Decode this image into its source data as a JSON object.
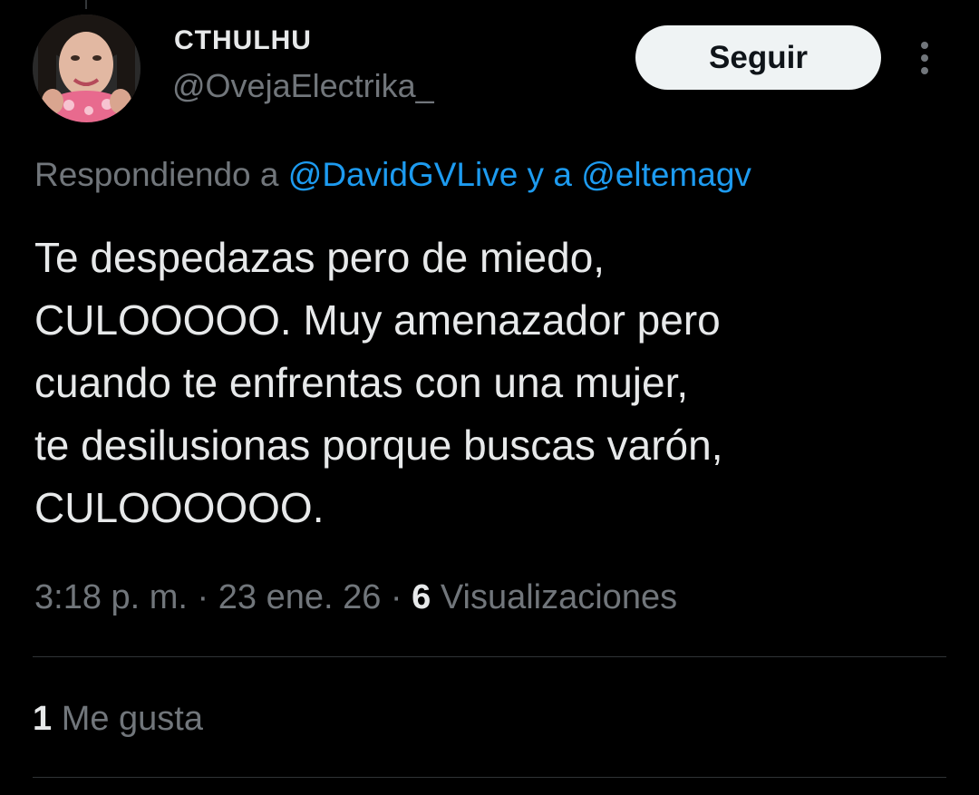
{
  "user": {
    "display_name": "CTHULHU",
    "handle": "@OvejaElectrika_"
  },
  "follow_label": "Seguir",
  "reply_context": {
    "prefix": "Respondiendo a ",
    "mention_1": "@DavidGVLive",
    "conjunction": " y a ",
    "mention_2": "@eltemagv"
  },
  "tweet": {
    "lines": [
      "Te despedazas pero de miedo,",
      "CULOOOOO. Muy amenazador pero",
      "cuando te enfrentas con una mujer,",
      "te desilusionas porque buscas varón,",
      "CULOOOOOO."
    ]
  },
  "meta": {
    "time": "3:18 p. m.",
    "separator": " · ",
    "date": "23 ene. 26",
    "views_count": "6",
    "views_label": " Visualizaciones"
  },
  "likes": {
    "count": "1",
    "label": " Me gusta"
  },
  "colors": {
    "background": "#000000",
    "text": "#e7e9ea",
    "secondary": "#71767b",
    "link": "#1d9bf0",
    "button_bg": "#eff3f4",
    "divider": "#2f3336"
  },
  "icons": {
    "more": "more-vertical-icon",
    "avatar": "profile-photo"
  }
}
